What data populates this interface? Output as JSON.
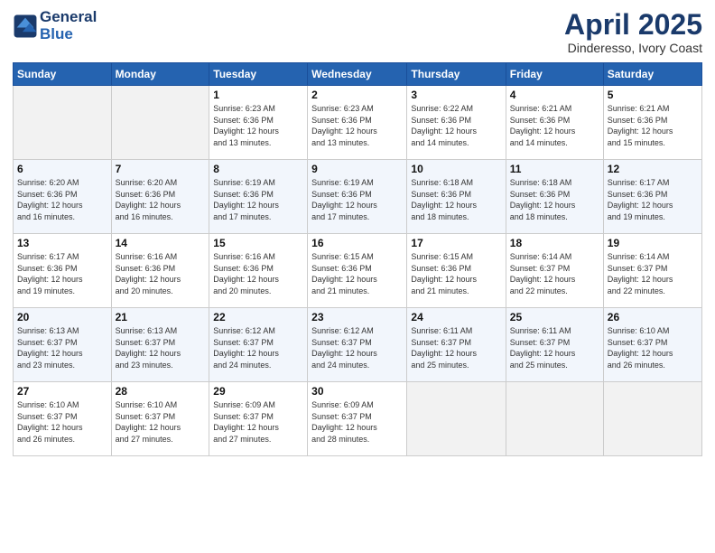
{
  "header": {
    "logo_line1": "General",
    "logo_line2": "Blue",
    "month_title": "April 2025",
    "location": "Dinderesso, Ivory Coast"
  },
  "weekdays": [
    "Sunday",
    "Monday",
    "Tuesday",
    "Wednesday",
    "Thursday",
    "Friday",
    "Saturday"
  ],
  "weeks": [
    [
      {
        "day": "",
        "sunrise": "",
        "sunset": "",
        "daylight": ""
      },
      {
        "day": "",
        "sunrise": "",
        "sunset": "",
        "daylight": ""
      },
      {
        "day": "1",
        "sunrise": "Sunrise: 6:23 AM",
        "sunset": "Sunset: 6:36 PM",
        "daylight": "Daylight: 12 hours and 13 minutes."
      },
      {
        "day": "2",
        "sunrise": "Sunrise: 6:23 AM",
        "sunset": "Sunset: 6:36 PM",
        "daylight": "Daylight: 12 hours and 13 minutes."
      },
      {
        "day": "3",
        "sunrise": "Sunrise: 6:22 AM",
        "sunset": "Sunset: 6:36 PM",
        "daylight": "Daylight: 12 hours and 14 minutes."
      },
      {
        "day": "4",
        "sunrise": "Sunrise: 6:21 AM",
        "sunset": "Sunset: 6:36 PM",
        "daylight": "Daylight: 12 hours and 14 minutes."
      },
      {
        "day": "5",
        "sunrise": "Sunrise: 6:21 AM",
        "sunset": "Sunset: 6:36 PM",
        "daylight": "Daylight: 12 hours and 15 minutes."
      }
    ],
    [
      {
        "day": "6",
        "sunrise": "Sunrise: 6:20 AM",
        "sunset": "Sunset: 6:36 PM",
        "daylight": "Daylight: 12 hours and 16 minutes."
      },
      {
        "day": "7",
        "sunrise": "Sunrise: 6:20 AM",
        "sunset": "Sunset: 6:36 PM",
        "daylight": "Daylight: 12 hours and 16 minutes."
      },
      {
        "day": "8",
        "sunrise": "Sunrise: 6:19 AM",
        "sunset": "Sunset: 6:36 PM",
        "daylight": "Daylight: 12 hours and 17 minutes."
      },
      {
        "day": "9",
        "sunrise": "Sunrise: 6:19 AM",
        "sunset": "Sunset: 6:36 PM",
        "daylight": "Daylight: 12 hours and 17 minutes."
      },
      {
        "day": "10",
        "sunrise": "Sunrise: 6:18 AM",
        "sunset": "Sunset: 6:36 PM",
        "daylight": "Daylight: 12 hours and 18 minutes."
      },
      {
        "day": "11",
        "sunrise": "Sunrise: 6:18 AM",
        "sunset": "Sunset: 6:36 PM",
        "daylight": "Daylight: 12 hours and 18 minutes."
      },
      {
        "day": "12",
        "sunrise": "Sunrise: 6:17 AM",
        "sunset": "Sunset: 6:36 PM",
        "daylight": "Daylight: 12 hours and 19 minutes."
      }
    ],
    [
      {
        "day": "13",
        "sunrise": "Sunrise: 6:17 AM",
        "sunset": "Sunset: 6:36 PM",
        "daylight": "Daylight: 12 hours and 19 minutes."
      },
      {
        "day": "14",
        "sunrise": "Sunrise: 6:16 AM",
        "sunset": "Sunset: 6:36 PM",
        "daylight": "Daylight: 12 hours and 20 minutes."
      },
      {
        "day": "15",
        "sunrise": "Sunrise: 6:16 AM",
        "sunset": "Sunset: 6:36 PM",
        "daylight": "Daylight: 12 hours and 20 minutes."
      },
      {
        "day": "16",
        "sunrise": "Sunrise: 6:15 AM",
        "sunset": "Sunset: 6:36 PM",
        "daylight": "Daylight: 12 hours and 21 minutes."
      },
      {
        "day": "17",
        "sunrise": "Sunrise: 6:15 AM",
        "sunset": "Sunset: 6:36 PM",
        "daylight": "Daylight: 12 hours and 21 minutes."
      },
      {
        "day": "18",
        "sunrise": "Sunrise: 6:14 AM",
        "sunset": "Sunset: 6:37 PM",
        "daylight": "Daylight: 12 hours and 22 minutes."
      },
      {
        "day": "19",
        "sunrise": "Sunrise: 6:14 AM",
        "sunset": "Sunset: 6:37 PM",
        "daylight": "Daylight: 12 hours and 22 minutes."
      }
    ],
    [
      {
        "day": "20",
        "sunrise": "Sunrise: 6:13 AM",
        "sunset": "Sunset: 6:37 PM",
        "daylight": "Daylight: 12 hours and 23 minutes."
      },
      {
        "day": "21",
        "sunrise": "Sunrise: 6:13 AM",
        "sunset": "Sunset: 6:37 PM",
        "daylight": "Daylight: 12 hours and 23 minutes."
      },
      {
        "day": "22",
        "sunrise": "Sunrise: 6:12 AM",
        "sunset": "Sunset: 6:37 PM",
        "daylight": "Daylight: 12 hours and 24 minutes."
      },
      {
        "day": "23",
        "sunrise": "Sunrise: 6:12 AM",
        "sunset": "Sunset: 6:37 PM",
        "daylight": "Daylight: 12 hours and 24 minutes."
      },
      {
        "day": "24",
        "sunrise": "Sunrise: 6:11 AM",
        "sunset": "Sunset: 6:37 PM",
        "daylight": "Daylight: 12 hours and 25 minutes."
      },
      {
        "day": "25",
        "sunrise": "Sunrise: 6:11 AM",
        "sunset": "Sunset: 6:37 PM",
        "daylight": "Daylight: 12 hours and 25 minutes."
      },
      {
        "day": "26",
        "sunrise": "Sunrise: 6:10 AM",
        "sunset": "Sunset: 6:37 PM",
        "daylight": "Daylight: 12 hours and 26 minutes."
      }
    ],
    [
      {
        "day": "27",
        "sunrise": "Sunrise: 6:10 AM",
        "sunset": "Sunset: 6:37 PM",
        "daylight": "Daylight: 12 hours and 26 minutes."
      },
      {
        "day": "28",
        "sunrise": "Sunrise: 6:10 AM",
        "sunset": "Sunset: 6:37 PM",
        "daylight": "Daylight: 12 hours and 27 minutes."
      },
      {
        "day": "29",
        "sunrise": "Sunrise: 6:09 AM",
        "sunset": "Sunset: 6:37 PM",
        "daylight": "Daylight: 12 hours and 27 minutes."
      },
      {
        "day": "30",
        "sunrise": "Sunrise: 6:09 AM",
        "sunset": "Sunset: 6:37 PM",
        "daylight": "Daylight: 12 hours and 28 minutes."
      },
      {
        "day": "",
        "sunrise": "",
        "sunset": "",
        "daylight": ""
      },
      {
        "day": "",
        "sunrise": "",
        "sunset": "",
        "daylight": ""
      },
      {
        "day": "",
        "sunrise": "",
        "sunset": "",
        "daylight": ""
      }
    ]
  ]
}
